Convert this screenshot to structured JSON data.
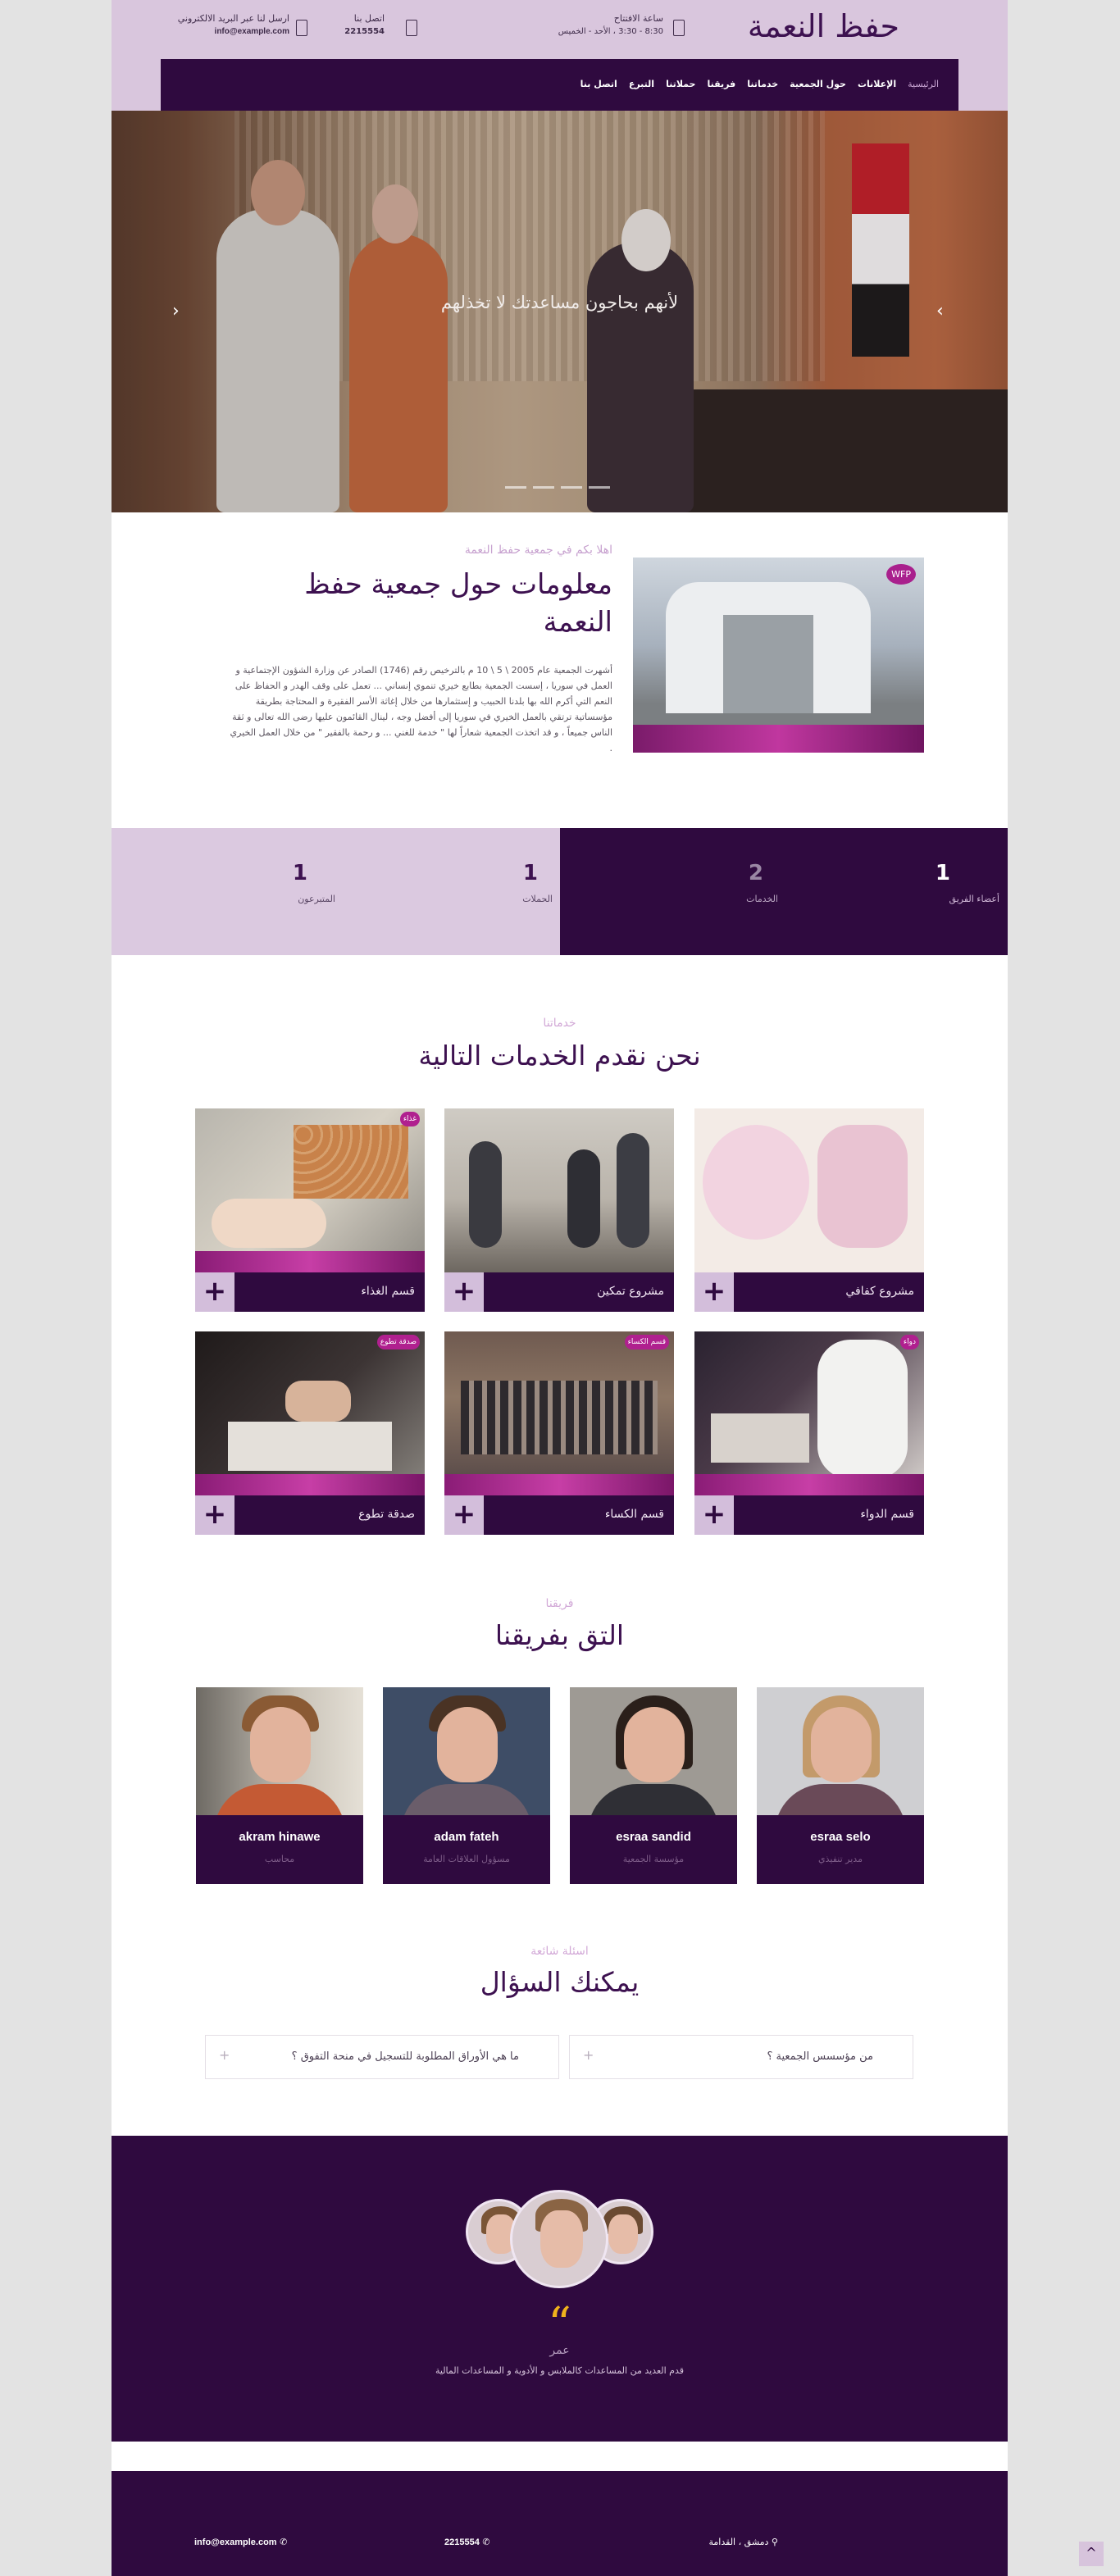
{
  "header": {
    "logo": "حفظ النعمة",
    "hours": {
      "title": "ساعة الافتتاح",
      "value": "8:30 - 3:30 ، الأحد - الخميس"
    },
    "phone": {
      "title": "اتصل بنا",
      "value": "2215554"
    },
    "email": {
      "title": "ارسل لنا عبر البريد الالكتروني",
      "value": "info@example.com"
    }
  },
  "nav": {
    "items": [
      "الرئيسية",
      "الإعلانات",
      "حول الجمعية",
      "خدماتنا",
      "فريقنا",
      "حملاتنا",
      "التبرع",
      "اتصل بنا"
    ]
  },
  "hero": {
    "caption": "لأنهم بحاجون مساعدتك لا تخذلهم",
    "prev": "‹",
    "next": "›"
  },
  "about": {
    "badge": "WFP",
    "kicker": "اهلا بكم في جمعية حفظ النعمة",
    "title": "معلومات حول جمعية حفظ النعمة",
    "text": "أشهرت الجمعية عام 2005 \\ 5 \\ 10 م بالترخيص رقم (1746) الصادر عن وزارة الشؤون الإجتماعية و العمل في سوريا ، إسست الجمعية بطابع خيري تنموي إنساني ... تعمل على وقف الهدر و الحفاظ على النعم التي أكرم الله بها بلدنا الحبيب و إستثمارها من خلال إغاثة الأسر الفقيرة و المحتاجة بطريقة مؤسساتية ترتقي بالعمل الخيري في سوريا إلى أفضل وجه ، لينال القائمون عليها رضى الله تعالى و ثقة الناس جميعاً ، و قد اتخذت الجمعية شعاراً لها \" خدمة للغني ... و رحمة بالفقير \" من خلال العمل الخيري ."
  },
  "stats": [
    {
      "number": "1",
      "label": "أعضاء الفريق"
    },
    {
      "number": "2",
      "label": "الخدمات"
    },
    {
      "number": "1",
      "label": "الحملات"
    },
    {
      "number": "1",
      "label": "المتبرعون"
    }
  ],
  "services": {
    "kicker": "خدماتنا",
    "title": "نحن نقدم الخدمات التالية",
    "plus": "+",
    "items": [
      {
        "title": "مشروع كفافي",
        "tag": ""
      },
      {
        "title": "مشروع تمكين",
        "tag": ""
      },
      {
        "title": "قسم الغذاء",
        "tag": "غذاء"
      },
      {
        "title": "قسم الدواء",
        "tag": "دواء"
      },
      {
        "title": "قسم الكساء",
        "tag": "قسم الكساء"
      },
      {
        "title": "صدقة تطوع",
        "tag": "صدقة تطوع"
      }
    ]
  },
  "team": {
    "kicker": "فريقنا",
    "title": "التق بفريقنا",
    "members": [
      {
        "name": "esraa selo",
        "role": "مدير تنفيذي"
      },
      {
        "name": "esraa sandid",
        "role": "مؤسسة الجمعية"
      },
      {
        "name": "adam fateh",
        "role": "مسؤول العلاقات العامة"
      },
      {
        "name": "akram hinawe",
        "role": "محاسب"
      }
    ]
  },
  "faq": {
    "kicker": "اسئلة شائعة",
    "title": "يمكنك السؤال",
    "items": [
      {
        "question": "من مؤسسس الجمعية ؟",
        "icon": "+"
      },
      {
        "question": "ما هي الأوراق المطلوبة للتسجيل في منحة التفوق ؟",
        "icon": "+"
      }
    ]
  },
  "testimonial": {
    "quote_mark": "“",
    "name": "عمر",
    "text": "قدم العديد من المساعدات كالملابس و الأدوية و المساعدات المالية"
  },
  "footer": {
    "address": "دمشق ، القدامة",
    "phone": "2215554",
    "email": "info@example.com"
  },
  "back_to_top": "^",
  "colors": {
    "primary": "#2f0a3f",
    "light": "#d9c6dd",
    "accent": "#c0379f",
    "quote": "#f0b21c"
  }
}
